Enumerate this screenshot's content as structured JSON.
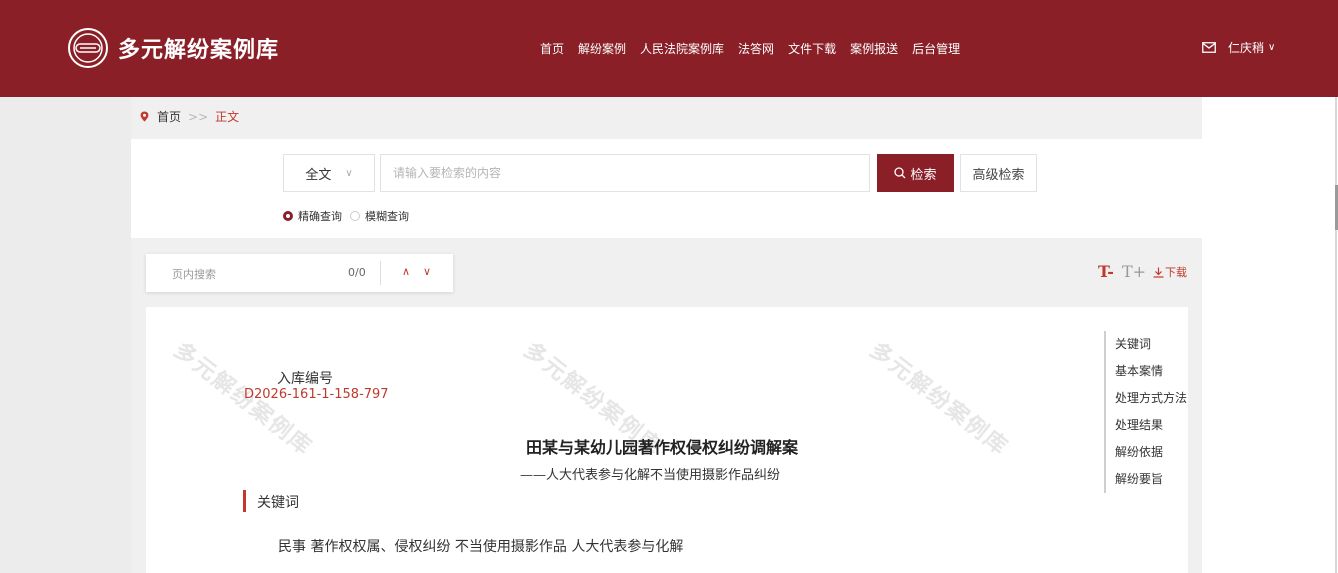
{
  "header": {
    "logo_icon": "circle-emblem-icon",
    "title": "多元解纷案例库",
    "nav": [
      "首页",
      "解纷案例",
      "人民法院案例库",
      "法答网",
      "文件下载",
      "案例报送",
      "后台管理"
    ],
    "user": {
      "icon": "mail-icon",
      "name": "仁庆稍",
      "caret": "∨"
    },
    "bg_color": "#8a1f27"
  },
  "breadcrumb": {
    "icon": "location-pin-icon",
    "home": "首页",
    "separator": ">>",
    "current": "正文"
  },
  "search": {
    "scope": "全文",
    "placeholder": "请输入要检索的内容",
    "value": "",
    "search_button": "检索",
    "advanced_button": "高级检索",
    "modes": [
      {
        "label": "精确查询",
        "selected": true
      },
      {
        "label": "模糊查询",
        "selected": false
      }
    ]
  },
  "find_in_page": {
    "label": "页内搜索",
    "count": "0/0",
    "up": "∧",
    "down": "∨"
  },
  "tools": {
    "font_decrease": "T-",
    "font_increase": "T+",
    "download": "下载"
  },
  "document": {
    "watermark": "多元解纷案例库",
    "entry_label": "入库编号",
    "entry_code": "D2026-161-1-158-797",
    "title": "田某与某幼儿园著作权侵权纠纷调解案",
    "subtitle": "——人大代表参与化解不当使用摄影作品纠纷",
    "section_title": "关键词",
    "keywords": "民事 著作权权属、侵权纠纷 不当使用摄影作品 人大代表参与化解"
  },
  "toc": [
    "关键词",
    "基本案情",
    "处理方式方法",
    "处理结果",
    "解纷依据",
    "解纷要旨"
  ],
  "accent_color": "#c0392b"
}
